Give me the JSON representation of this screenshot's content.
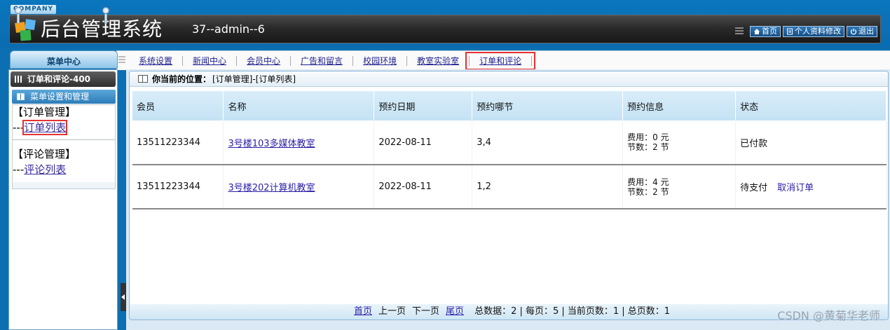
{
  "header": {
    "company_tag": "COMPANY",
    "title": "后台管理系统",
    "user_info": "37--admin--6",
    "buttons": [
      {
        "label": "首页",
        "icon": "home-icon"
      },
      {
        "label": "个人资料修改",
        "icon": "profile-icon"
      },
      {
        "label": "退出",
        "icon": "power-icon"
      }
    ]
  },
  "nav": {
    "items": [
      "系统设置",
      "新闻中心",
      "会员中心",
      "广告和留言",
      "校园环境",
      "教室实验室",
      "订单和评论"
    ],
    "active_index": 6
  },
  "sidebar": {
    "menu_center": "菜单中心",
    "section_title": "订单和评论-400",
    "sub_title": "菜单设置和管理",
    "groups": [
      {
        "title": "【订单管理】",
        "prefix": "---",
        "link": "订单列表"
      },
      {
        "title": "【评论管理】",
        "prefix": "---",
        "link": "评论列表"
      }
    ]
  },
  "location": {
    "label": "你当前的位置：",
    "path": "[订单管理]-[订单列表]"
  },
  "table": {
    "headers": [
      "会员",
      "名称",
      "预约日期",
      "预约哪节",
      "预约信息",
      "状态"
    ],
    "rows": [
      {
        "member": "13511223344",
        "name": "3号楼103多媒体教室",
        "date": "2022-08-11",
        "sections": "3,4",
        "fee": "费用：0 元",
        "count": "节数：2 节",
        "status": "已付款",
        "action": ""
      },
      {
        "member": "13511223344",
        "name": "3号楼202计算机教室",
        "date": "2022-08-11",
        "sections": "1,2",
        "fee": "费用：4 元",
        "count": "节数：2 节",
        "status": "待支付",
        "action": "取消订单"
      }
    ]
  },
  "pager": {
    "first": "首页",
    "prev": "上一页",
    "next": "下一页",
    "last": "尾页",
    "stats": "总数据：2 | 每页：5 | 当前页数：1 | 总页数：1"
  },
  "watermark": "CSDN @黄菊华老师",
  "colors": {
    "header_blue": "#0a6bb0",
    "link": "#2b1fa6",
    "highlight": "#e43232"
  }
}
